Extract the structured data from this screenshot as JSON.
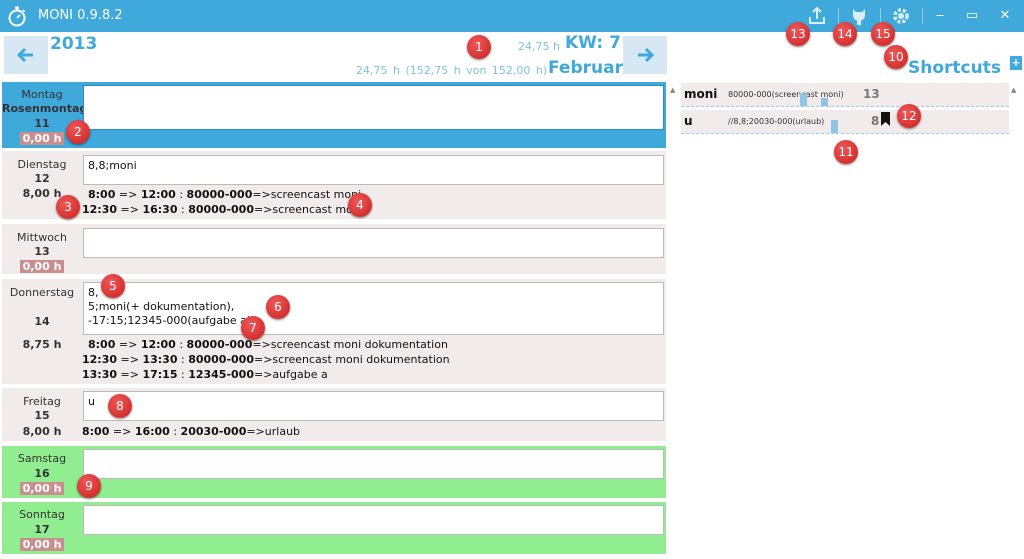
{
  "window": {
    "title": "MONI 0.9.8.2",
    "controls": {
      "minimize": "‒",
      "maximize": "▭",
      "close": "✕"
    }
  },
  "header": {
    "year": "2013",
    "week_hours": "24,75 h",
    "week_label": "KW: 7",
    "month_summary": "24,75 h  (152,75 h  von  152,00 h)",
    "month": "Februar"
  },
  "days": [
    {
      "name": "Montag",
      "holiday": "Rosenmontag",
      "num": "11",
      "hours": "0,00 h",
      "entry": "",
      "segments": []
    },
    {
      "name": "Dienstag",
      "num": "12",
      "hours": "8,00 h",
      "entry": "8,8;moni",
      "segments": [
        {
          "from": "8:00",
          "to": "12:00",
          "code": "80000-000",
          "desc": "screencast moni"
        },
        {
          "from": "12:30",
          "to": "16:30",
          "code": "80000-000",
          "desc": "screencast moni"
        }
      ]
    },
    {
      "name": "Mittwoch",
      "num": "13",
      "hours": "0,00 h",
      "entry": "",
      "segments": []
    },
    {
      "name": "Donnerstag",
      "num": "14",
      "hours": "8,75 h",
      "entry": "8,\n5;moni(+ dokumentation),\n-17:15;12345-000(aufgabe a)",
      "segments": [
        {
          "from": "8:00",
          "to": "12:00",
          "code": "80000-000",
          "desc": "screencast moni dokumentation"
        },
        {
          "from": "12:30",
          "to": "13:30",
          "code": "80000-000",
          "desc": "screencast moni dokumentation"
        },
        {
          "from": "13:30",
          "to": "17:15",
          "code": "12345-000",
          "desc": "aufgabe a"
        }
      ]
    },
    {
      "name": "Freitag",
      "num": "15",
      "hours": "8,00 h",
      "entry": "u",
      "segments": [
        {
          "from": "8:00",
          "to": "16:00",
          "code": "20030-000",
          "desc": "urlaub"
        }
      ]
    },
    {
      "name": "Samstag",
      "num": "16",
      "hours": "0,00 h",
      "entry": "",
      "segments": []
    },
    {
      "name": "Sonntag",
      "num": "17",
      "hours": "0,00 h",
      "entry": "",
      "segments": []
    }
  ],
  "arrows": {
    "arrow": "=>",
    "colon": ":",
    "arrow2": "=>"
  },
  "shortcuts": {
    "title": "Shortcuts",
    "add": "+",
    "items": [
      {
        "key": "moni",
        "value": "80000-000(screencast moni)",
        "count": "13",
        "bar_fraction": 0.45
      },
      {
        "key": "u",
        "value": "//8,8;20030-000(urlaub)",
        "count": "8",
        "bar_fraction": 0.32
      }
    ]
  },
  "badges": [
    "1",
    "2",
    "3",
    "4",
    "5",
    "6",
    "7",
    "8",
    "9",
    "10",
    "11",
    "12",
    "13",
    "14",
    "15"
  ],
  "colors": {
    "accent": "#3fa9dc",
    "today": "#3fa9dc",
    "weekend": "#90ee90",
    "weekday": "#f1ebeb",
    "zero_hours": "#c98f8f",
    "badge": "#d32626"
  },
  "icons": {
    "logo": "stopwatch-icon",
    "export": "export-icon",
    "github": "github-icon",
    "settings": "gear-icon",
    "prev": "arrow-left-icon",
    "next": "arrow-right-icon",
    "bookmark": "bookmark-icon"
  }
}
